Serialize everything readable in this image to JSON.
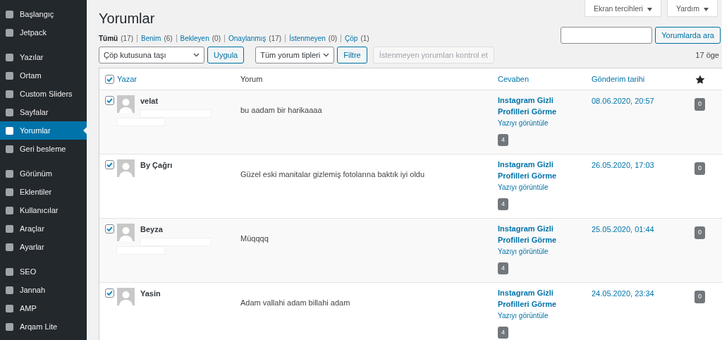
{
  "sidebar": {
    "groups": [
      [
        {
          "label": "Başlangıç",
          "selected": false
        },
        {
          "label": "Jetpack",
          "selected": false
        }
      ],
      [
        {
          "label": "Yazılar",
          "selected": false
        },
        {
          "label": "Ortam",
          "selected": false
        },
        {
          "label": "Custom Sliders",
          "selected": false
        },
        {
          "label": "Sayfalar",
          "selected": false
        },
        {
          "label": "Yorumlar",
          "selected": true
        },
        {
          "label": "Geri besleme",
          "selected": false
        }
      ],
      [
        {
          "label": "Görünüm",
          "selected": false
        },
        {
          "label": "Eklentiler",
          "selected": false
        },
        {
          "label": "Kullanıcılar",
          "selected": false
        },
        {
          "label": "Araçlar",
          "selected": false
        },
        {
          "label": "Ayarlar",
          "selected": false
        }
      ],
      [
        {
          "label": "SEO",
          "selected": false
        },
        {
          "label": "Jannah",
          "selected": false
        },
        {
          "label": "AMP",
          "selected": false
        },
        {
          "label": "Arqam Lite",
          "selected": false
        }
      ]
    ]
  },
  "screen_options": [
    "Ekran tercihleri",
    "Yardım"
  ],
  "title": "Yorumlar",
  "filters": [
    {
      "label": "Tümü",
      "count": "(17)",
      "selected": true
    },
    {
      "label": "Benim",
      "count": "(6)",
      "selected": false
    },
    {
      "label": "Bekleyen",
      "count": "(0)",
      "selected": false
    },
    {
      "label": "Onaylanmış",
      "count": "(17)",
      "selected": false
    },
    {
      "label": "İstenmeyen",
      "count": "(0)",
      "selected": false
    },
    {
      "label": "Çöp",
      "count": "(1)",
      "selected": false
    }
  ],
  "search": {
    "button": "Yorumlarda ara"
  },
  "bulk_action": {
    "value": "Çöp kutusuna taşı",
    "button": "Uygula"
  },
  "type_filter": {
    "value": "Tüm yorum tipleri",
    "button": "Filtre"
  },
  "spam_check": {
    "label": "İstenmeyen yorumları kontrol et",
    "disabled": true
  },
  "item_count": "17 öge",
  "table": {
    "select_all": true,
    "columns": [
      "Yazar",
      "Yorum",
      "Cevaben",
      "Gönderim tarihi"
    ],
    "rows": [
      {
        "checked": true,
        "author": "velat",
        "redacted": true,
        "comment": "bu aadam bir harikaaaa",
        "post": "Instagram Gizli Profilleri Görme",
        "view": "Yazıyı görüntüle",
        "post_count": "4",
        "date": "08.06.2020, 20:57",
        "count": "0"
      },
      {
        "checked": true,
        "author": "By Çağrı",
        "redacted": false,
        "comment": "Güzel eski manitalar gizlemiş fotolarına baktık iyi oldu",
        "post": "Instagram Gizli Profilleri Görme",
        "view": "Yazıyı görüntüle",
        "post_count": "4",
        "date": "26.05.2020, 17:03",
        "count": "0"
      },
      {
        "checked": true,
        "author": "Beyza",
        "redacted": true,
        "comment": "Müqqqq",
        "post": "Instagram Gizli Profilleri Görme",
        "view": "Yazıyı görüntüle",
        "post_count": "4",
        "date": "25.05.2020, 01:44",
        "count": "0"
      },
      {
        "checked": true,
        "author": "Yasin",
        "redacted": false,
        "comment": "Adam vallahi adam billahi adam",
        "post": "Instagram Gizli Profilleri Görme",
        "view": "Yazıyı görüntüle",
        "post_count": "4",
        "date": "24.05.2020, 23:34",
        "count": "0"
      }
    ]
  }
}
